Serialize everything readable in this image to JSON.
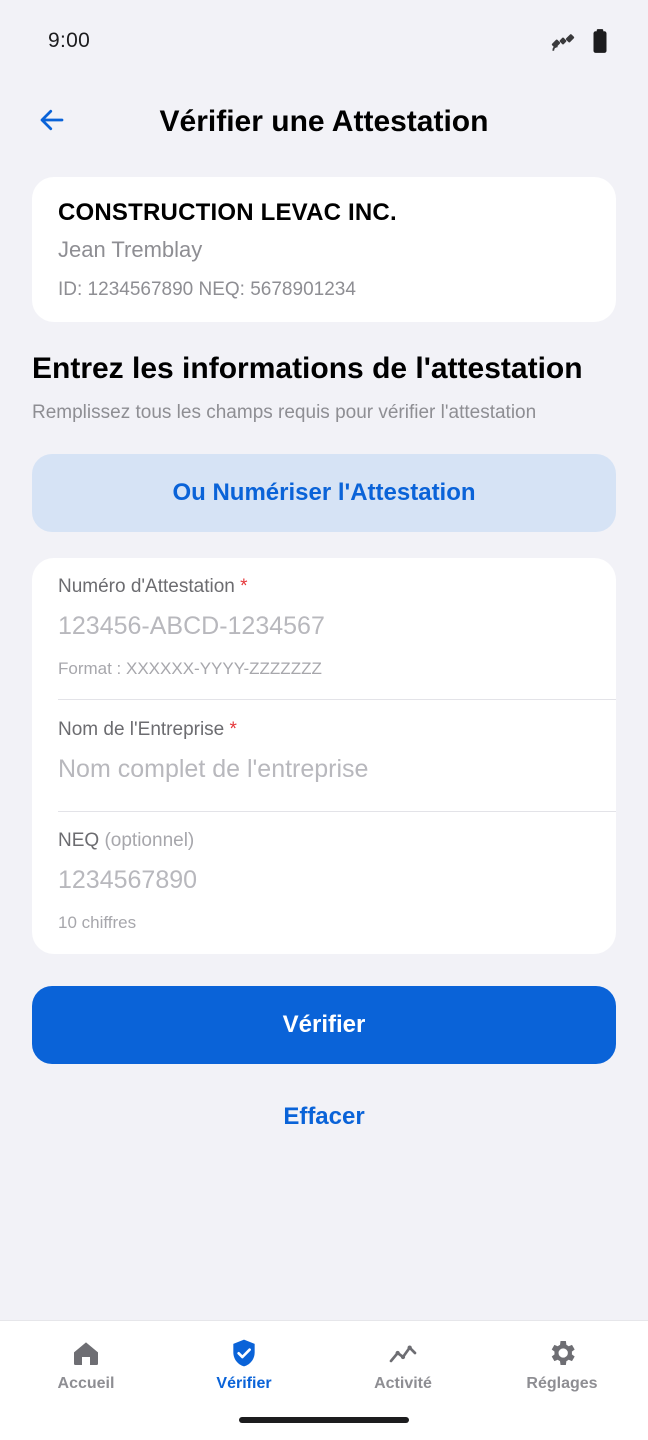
{
  "status_bar": {
    "time": "9:00",
    "icons": [
      "satellite-icon",
      "battery-icon"
    ]
  },
  "header": {
    "title": "Vérifier une Attestation",
    "back_icon": "arrow-left-icon"
  },
  "profile": {
    "company": "CONSTRUCTION LEVAC INC.",
    "person": "Jean Tremblay",
    "ids": "ID: 1234567890 NEQ: 5678901234"
  },
  "section": {
    "title": "Entrez les informations de l'attestation",
    "subtitle": "Remplissez tous les champs requis pour vérifier l'attestation"
  },
  "scan_button": {
    "label": "Ou Numériser l'Attestation"
  },
  "form": {
    "attestation": {
      "label": "Numéro d'Attestation",
      "required_mark": "*",
      "value": "",
      "placeholder": "123456-ABCD-1234567",
      "hint": "Format : XXXXXX-YYYY-ZZZZZZZ"
    },
    "company": {
      "label": "Nom de l'Entreprise",
      "required_mark": "*",
      "value": "",
      "placeholder": "Nom complet de l'entreprise"
    },
    "neq": {
      "label": "NEQ",
      "optional_mark": "(optionnel)",
      "value": "",
      "placeholder": "1234567890",
      "hint": "10 chiffres"
    }
  },
  "actions": {
    "verify_label": "Vérifier",
    "clear_label": "Effacer"
  },
  "tabs": [
    {
      "label": "Accueil",
      "icon": "home-icon",
      "active": false
    },
    {
      "label": "Vérifier",
      "icon": "shield-check-icon",
      "active": true
    },
    {
      "label": "Activité",
      "icon": "activity-chart-icon",
      "active": false
    },
    {
      "label": "Réglages",
      "icon": "gear-icon",
      "active": false
    }
  ],
  "colors": {
    "accent": "#0a63d8",
    "accent_soft": "#d6e3f5",
    "required": "#e5383b",
    "background": "#f2f2f7",
    "muted_text": "#8e8e93"
  }
}
